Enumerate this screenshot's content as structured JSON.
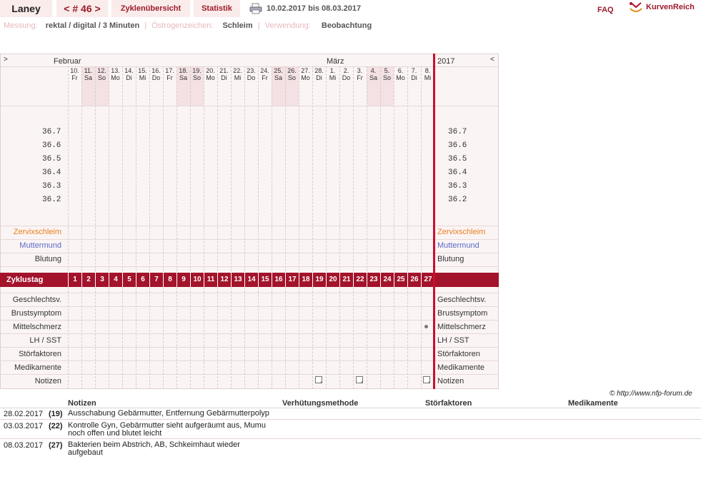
{
  "header": {
    "username": "Laney",
    "cycle_nav": "< # 46 >",
    "tab_overview": "Zyklenübersicht",
    "tab_stats": "Statistik",
    "date_range": "10.02.2017 bis 08.03.2017",
    "faq": "FAQ",
    "logo": "KurvenReich"
  },
  "meta": {
    "measure_label": "Messung:",
    "measure_value": "rektal / digital / 3 Minuten",
    "sep": "|",
    "estrogen_label": "Östrogenzeichen:",
    "estrogen_value": "Schleim",
    "usage_label": "Verwendung:",
    "usage_value": "Beobachtung"
  },
  "chart": {
    "nav_prev": ">",
    "nav_next": "<",
    "month1": "Februar",
    "month2": "März",
    "year": "2017",
    "days": [
      {
        "d": "10.",
        "w": "Fr"
      },
      {
        "d": "11.",
        "w": "Sa"
      },
      {
        "d": "12.",
        "w": "So"
      },
      {
        "d": "13.",
        "w": "Mo"
      },
      {
        "d": "14.",
        "w": "Di"
      },
      {
        "d": "15.",
        "w": "Mi"
      },
      {
        "d": "16.",
        "w": "Do"
      },
      {
        "d": "17.",
        "w": "Fr"
      },
      {
        "d": "18.",
        "w": "Sa"
      },
      {
        "d": "19.",
        "w": "So"
      },
      {
        "d": "20.",
        "w": "Mo"
      },
      {
        "d": "21.",
        "w": "Di"
      },
      {
        "d": "22.",
        "w": "Mi"
      },
      {
        "d": "23.",
        "w": "Do"
      },
      {
        "d": "24.",
        "w": "Fr"
      },
      {
        "d": "25.",
        "w": "Sa"
      },
      {
        "d": "26.",
        "w": "So"
      },
      {
        "d": "27.",
        "w": "Mo"
      },
      {
        "d": "28.",
        "w": "Di"
      },
      {
        "d": "1.",
        "w": "Mi"
      },
      {
        "d": "2.",
        "w": "Do"
      },
      {
        "d": "3.",
        "w": "Fr"
      },
      {
        "d": "4.",
        "w": "Sa"
      },
      {
        "d": "5.",
        "w": "So"
      },
      {
        "d": "6.",
        "w": "Mo"
      },
      {
        "d": "7.",
        "w": "Di"
      },
      {
        "d": "8.",
        "w": "Mi"
      }
    ],
    "y_labels": [
      "36.7",
      "36.6",
      "36.5",
      "36.4",
      "36.3",
      "36.2"
    ],
    "rows_top": {
      "cervix": "Zervixschleim",
      "cervix_color": "#e87f1e",
      "mumu": "Muttermund",
      "mumu_color": "#5a6ac8",
      "bleeding": "Blutung"
    },
    "cycle_label": "Zyklustag",
    "cycle_days": [
      "1",
      "2",
      "3",
      "4",
      "5",
      "6",
      "7",
      "8",
      "9",
      "10",
      "11",
      "12",
      "13",
      "14",
      "15",
      "16",
      "17",
      "18",
      "19",
      "20",
      "21",
      "22",
      "23",
      "24",
      "25",
      "26",
      "27"
    ],
    "rows_bottom": [
      "Geschlechtsv.",
      "Brustsymptom",
      "Mittelschmerz",
      "LH / SST",
      "Störfaktoren",
      "Medikamente",
      "Notizen"
    ],
    "accent": "#a3132b"
  },
  "copyright": "© http://www.nfp-forum.de",
  "notes": {
    "headers": {
      "notes": "Notizen",
      "contra": "Verhütungsmethode",
      "disturb": "Störfaktoren",
      "meds": "Medikamente"
    },
    "rows": [
      {
        "date": "28.02.2017",
        "day": "(19)",
        "text": "Ausschabung Gebärmutter, Entfernung Gebärmutterpolyp"
      },
      {
        "date": "03.03.2017",
        "day": "(22)",
        "text": "Kontrolle Gyn, Gebärmutter sieht aufgeräumt aus, Mumu noch offen und blutet leicht"
      },
      {
        "date": "08.03.2017",
        "day": "(27)",
        "text": "Bakterien beim Abstrich, AB, Schkeimhaut wieder aufgebaut"
      }
    ]
  }
}
